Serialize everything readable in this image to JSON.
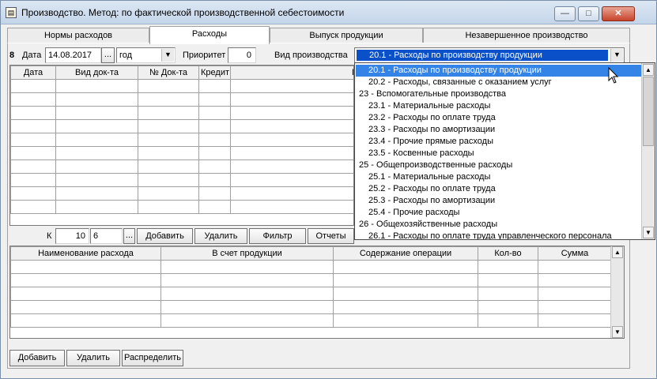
{
  "window": {
    "title": "Производство. Метод: по фактической производственной себестоимости",
    "minimize_glyph": "—",
    "maximize_glyph": "□",
    "close_glyph": "✕"
  },
  "tabs": [
    {
      "label": "Нормы расходов"
    },
    {
      "label": "Расходы"
    },
    {
      "label": "Выпуск продукции"
    },
    {
      "label": "Незавершенное производство"
    }
  ],
  "form": {
    "number": "8",
    "date_label": "Дата",
    "date_value": "14.08.2017",
    "ellipsis": "...",
    "period_value": "год",
    "priority_label": "Приоритет",
    "priority_value": "0",
    "production_type_label": "Вид производства",
    "production_type_value": "20.1  - Расходы по производству продукции"
  },
  "docs_table": {
    "headers": [
      "Дата",
      "Вид док-та",
      "№ Док-та",
      "Кредит",
      "Продукция"
    ]
  },
  "docs_controls": {
    "k_label": "К",
    "k_value": "10",
    "k_value2": "6",
    "ellipsis": "...",
    "add_label": "Добавить",
    "delete_label": "Удалить",
    "filter_label": "Фильтр",
    "reports_label": "Отчеты"
  },
  "expense_table": {
    "headers": [
      "Наименование расхода",
      "В счет продукции",
      "Содержание операции",
      "Кол-во",
      "Сумма"
    ]
  },
  "bottom_buttons": {
    "add_label": "Добавить",
    "delete_label": "Удалить",
    "distribute_label": "Распределить"
  },
  "dropdown": {
    "items": [
      {
        "label": "20.1  - Расходы по производству продукции",
        "indent": 1,
        "selected": true
      },
      {
        "label": "20.2  - Расходы, связанные с оказанием услуг",
        "indent": 1
      },
      {
        "label": "23 - Вспомогательные производства",
        "indent": 0
      },
      {
        "label": "23.1  - Материальные расходы",
        "indent": 1
      },
      {
        "label": "23.2  - Расходы по оплате труда",
        "indent": 1
      },
      {
        "label": "23.3  - Расходы по амортизации",
        "indent": 1
      },
      {
        "label": "23.4  - Прочие прямые расходы",
        "indent": 1
      },
      {
        "label": "23.5  - Косвенные расходы",
        "indent": 1
      },
      {
        "label": "25 - Общепроизводственные расходы",
        "indent": 0
      },
      {
        "label": "25.1  - Материальные расходы",
        "indent": 1
      },
      {
        "label": "25.2  - Расходы по оплате труда",
        "indent": 1
      },
      {
        "label": "25.3  - Расходы по амортизации",
        "indent": 1
      },
      {
        "label": "25.4  - Прочие расходы",
        "indent": 1
      },
      {
        "label": "26 - Общехозяйственные расходы",
        "indent": 0
      },
      {
        "label": "26.1  - Расходы по оплате труда управленческого персонала",
        "indent": 1
      }
    ]
  },
  "colors": {
    "selection": "#3384e6",
    "combo_selection": "#0a50c8",
    "close_button": "#c7432a"
  }
}
